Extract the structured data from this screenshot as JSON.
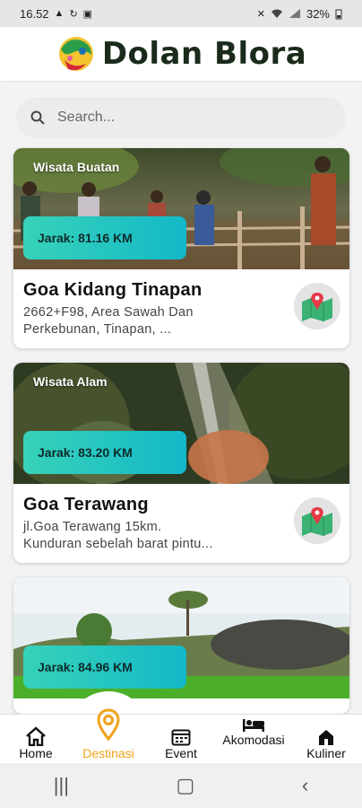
{
  "status": {
    "time": "16.52",
    "left_icons": [
      "warning-icon",
      "sync-icon",
      "image-icon"
    ],
    "right_icons": [
      "mute-icon",
      "wifi-icon",
      "signal-icon",
      "battery-icon"
    ],
    "battery": "32%"
  },
  "header": {
    "title": "Dolan Blora",
    "logo": "dolan-blora-logo"
  },
  "search": {
    "placeholder": "Search...",
    "icon": "search-icon"
  },
  "cards": [
    {
      "category": "Wisata Buatan",
      "distance": "Jarak: 81.16 KM",
      "title": "Goa Kidang Tinapan",
      "address_line1": "2662+F98, Area Sawah Dan",
      "address_line2": "Perkebunan, Tinapan, ...",
      "icon": "map-pin-icon"
    },
    {
      "category": "Wisata Alam",
      "distance": "Jarak: 83.20 KM",
      "title": "Goa Terawang",
      "address_line1": "jl.Goa Terawang 15km.",
      "address_line2": "Kunduran sebelah barat pintu...",
      "icon": "map-pin-icon"
    },
    {
      "category": "",
      "distance": "Jarak: 84.96 KM",
      "title": "",
      "address_line1": "",
      "address_line2": "",
      "icon": "map-pin-icon"
    }
  ],
  "nav": {
    "items": [
      {
        "label": "Home",
        "icon": "home-icon"
      },
      {
        "label": "Destinasi",
        "icon": "location-pin-icon",
        "active": true
      },
      {
        "label": "Event",
        "icon": "calendar-icon"
      },
      {
        "label": "Akomodasi",
        "icon": "bed-icon"
      },
      {
        "label": "Kuliner",
        "icon": "restaurant-icon"
      }
    ]
  },
  "colors": {
    "accent": "#f0a21a",
    "distance_start": "#37d2b9",
    "distance_end": "#14b8c8"
  }
}
